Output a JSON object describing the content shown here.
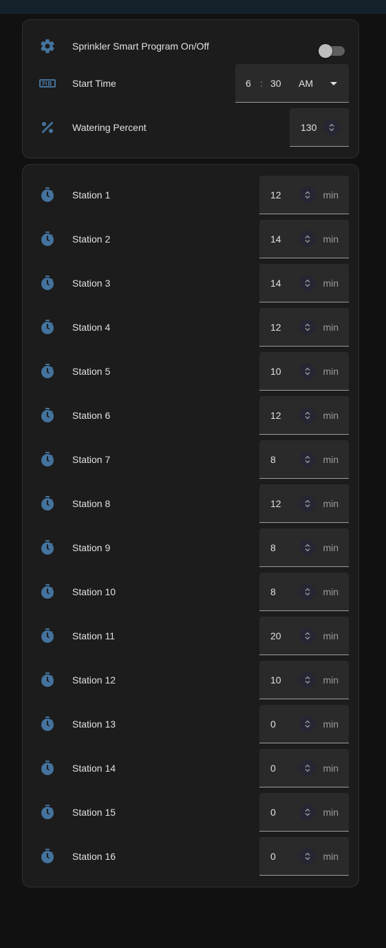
{
  "program": {
    "toggle_label": "Sprinkler Smart Program On/Off",
    "toggle_on": false,
    "start_time_label": "Start Time",
    "start_time": {
      "hour": "6",
      "separator": ":",
      "minute": "30",
      "ampm": "AM"
    },
    "watering_label": "Watering Percent",
    "watering_percent": "130"
  },
  "stations": [
    {
      "label": "Station 1",
      "value": "12",
      "unit": "min"
    },
    {
      "label": "Station 2",
      "value": "14",
      "unit": "min"
    },
    {
      "label": "Station 3",
      "value": "14",
      "unit": "min"
    },
    {
      "label": "Station 4",
      "value": "12",
      "unit": "min"
    },
    {
      "label": "Station 5",
      "value": "10",
      "unit": "min"
    },
    {
      "label": "Station 6",
      "value": "12",
      "unit": "min"
    },
    {
      "label": "Station 7",
      "value": "8",
      "unit": "min"
    },
    {
      "label": "Station 8",
      "value": "12",
      "unit": "min"
    },
    {
      "label": "Station 9",
      "value": "8",
      "unit": "min"
    },
    {
      "label": "Station 10",
      "value": "8",
      "unit": "min"
    },
    {
      "label": "Station 11",
      "value": "20",
      "unit": "min"
    },
    {
      "label": "Station 12",
      "value": "10",
      "unit": "min"
    },
    {
      "label": "Station 13",
      "value": "0",
      "unit": "min"
    },
    {
      "label": "Station 14",
      "value": "0",
      "unit": "min"
    },
    {
      "label": "Station 15",
      "value": "0",
      "unit": "min"
    },
    {
      "label": "Station 16",
      "value": "0",
      "unit": "min"
    }
  ],
  "icons": {
    "program_toggle": "gear-icon",
    "start_time": "clock-digital-icon",
    "watering": "percent-icon",
    "station": "timer-icon"
  },
  "colors": {
    "accent": "#44739e",
    "card": "#1c1c1c",
    "background": "#111111"
  }
}
